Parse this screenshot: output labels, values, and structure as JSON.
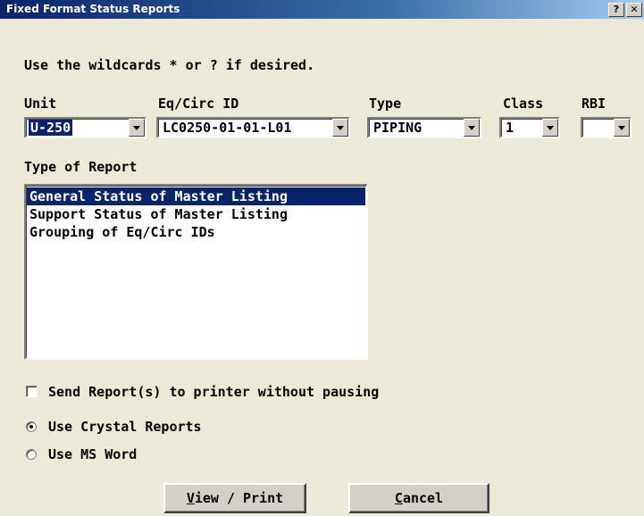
{
  "window": {
    "title": "Fixed Format Status Reports",
    "help_button": "?",
    "close_button": "✕"
  },
  "instructions": "Use the wildcards * or ? if desired.",
  "fields": {
    "unit": {
      "label": "Unit",
      "value": "U-250"
    },
    "eq_circ_id": {
      "label": "Eq/Circ ID",
      "value": "LC0250-01-01-L01"
    },
    "type": {
      "label": "Type",
      "value": "PIPING"
    },
    "class": {
      "label": "Class",
      "value": "1"
    },
    "rbi": {
      "label": "RBI",
      "value": ""
    }
  },
  "report": {
    "label": "Type of Report",
    "items": [
      "General Status of Master Listing",
      "Support Status of Master Listing",
      "Grouping of Eq/Circ IDs"
    ],
    "selected_index": 0
  },
  "options": {
    "send_to_printer": {
      "label": "Send Report(s) to printer without pausing",
      "checked": false
    },
    "crystal_reports": {
      "label": "Use Crystal Reports",
      "selected": true
    },
    "ms_word": {
      "label": "Use MS Word",
      "selected": false
    }
  },
  "buttons": {
    "view_print": {
      "accel": "V",
      "rest": "iew / Print"
    },
    "cancel": {
      "accel": "C",
      "rest": "ancel"
    }
  }
}
